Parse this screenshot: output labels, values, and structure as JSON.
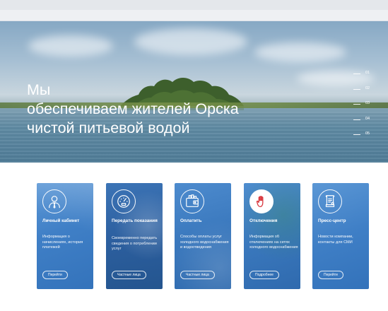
{
  "hero": {
    "title_lines": [
      "Мы",
      "обеспечиваем жителей Орска",
      "чистой питьевой водой"
    ],
    "slides": [
      "01",
      "02",
      "03",
      "04",
      "05"
    ]
  },
  "cards": [
    {
      "title": "Личный кабинет",
      "description": "Информация о начислениях, история платежей",
      "button": "Перейти",
      "icon": "user-tie-icon",
      "color": "#3f7fc6"
    },
    {
      "title": "Передать показания",
      "description": "Своевременно передать сведения о потреблении услуг",
      "button": "Частные лица",
      "icon": "gauge-icon",
      "color": "#2d63a8"
    },
    {
      "title": "Оплатить",
      "description": "Способы оплаты услуг холодного водоснабжения и водоотведения",
      "button": "Частные лица",
      "icon": "wallet-icon",
      "color": "#3a78bd"
    },
    {
      "title": "Отключения",
      "description": "Информация об отключениях на сетях холодного водоснабжения",
      "button": "Подробнее",
      "icon": "stop-hand-icon",
      "color": "#3a78bd"
    },
    {
      "title": "Пресс-центр",
      "description": "Новости компании, контакты для СМИ",
      "button": "Перейти",
      "icon": "document-icon",
      "color": "#3f7fc6"
    }
  ]
}
